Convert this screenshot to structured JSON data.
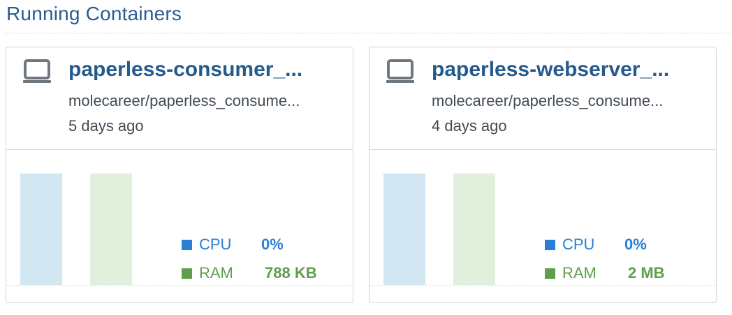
{
  "section": {
    "title": "Running Containers"
  },
  "colors": {
    "title": "#2a5d8f",
    "container_name": "#255a8c",
    "cpu": "#2a7fd6",
    "ram": "#5f9e4c",
    "cpu_bar": "#d3e7f3",
    "ram_bar": "#e1f0dc"
  },
  "containers": [
    {
      "icon": "monitor-icon",
      "name": "paperless-consumer_...",
      "image": "molecareer/paperless_consume...",
      "age": "5 days ago",
      "cpu_label": "CPU",
      "cpu_value": "0%",
      "ram_label": "RAM",
      "ram_value": "788 KB"
    },
    {
      "icon": "monitor-icon",
      "name": "paperless-webserver_...",
      "image": "molecareer/paperless_consume...",
      "age": "4 days ago",
      "cpu_label": "CPU",
      "cpu_value": "0%",
      "ram_label": "RAM",
      "ram_value": "2 MB"
    }
  ]
}
